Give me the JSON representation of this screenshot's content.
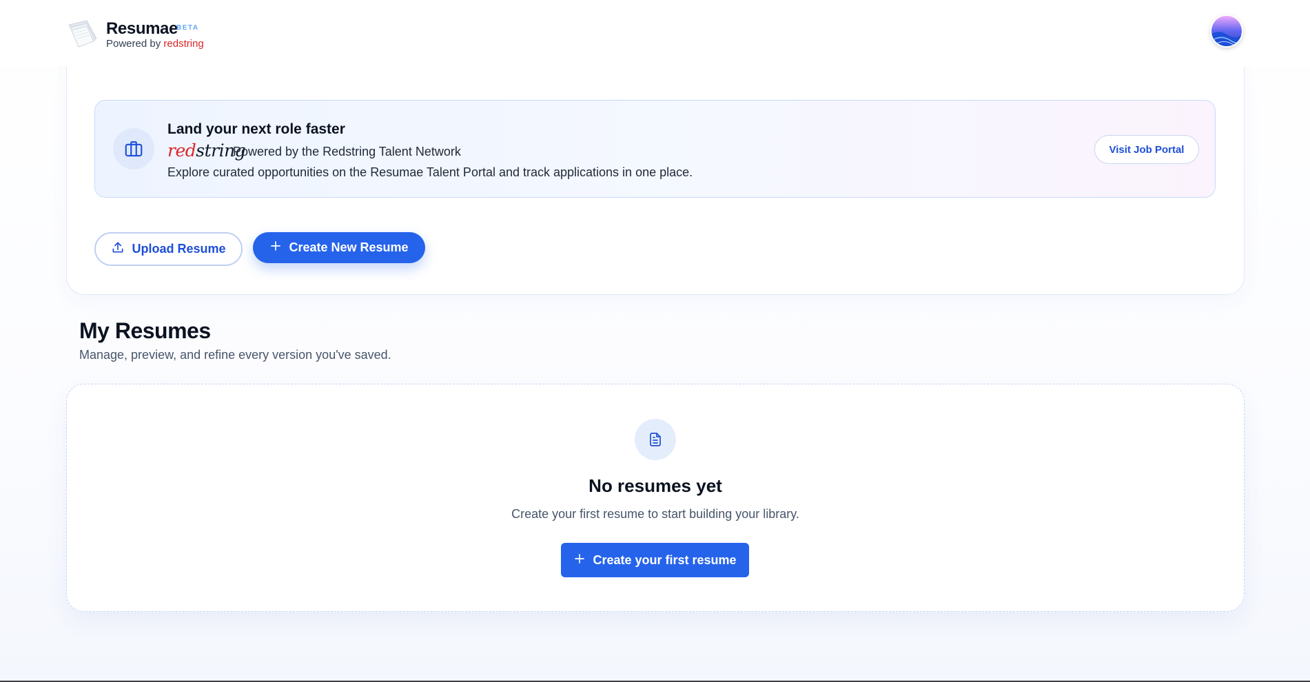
{
  "header": {
    "brand": "Resumae",
    "badge": "BETA",
    "powered_prefix": "Powered by",
    "powered_brand": "redstring",
    "logo_icon": "paper-stack-logo",
    "avatar_icon": "user-avatar"
  },
  "promo": {
    "icon": "briefcase-icon",
    "title": "Land your next role faster",
    "signature_red": "red",
    "signature_black": "string",
    "network_text": "Powered by the Redstring Talent Network",
    "description": "Explore curated opportunities on the Resumae Talent Portal and track applications in one place.",
    "cta_label": "Visit Job Portal"
  },
  "actions": {
    "upload_label": "Upload Resume",
    "upload_icon": "upload-icon",
    "create_label": "Create New Resume",
    "create_icon": "plus-icon"
  },
  "resumes": {
    "title": "My Resumes",
    "subtitle": "Manage, preview, and refine every version you've saved.",
    "empty": {
      "icon": "document-icon",
      "title": "No resumes yet",
      "subtitle": "Create your first resume to start building your library.",
      "cta_label": "Create your first resume"
    }
  },
  "colors": {
    "primary": "#2563eb",
    "brand_red": "#dc2626",
    "text_dark": "#0b1220",
    "text_muted": "#475569"
  }
}
